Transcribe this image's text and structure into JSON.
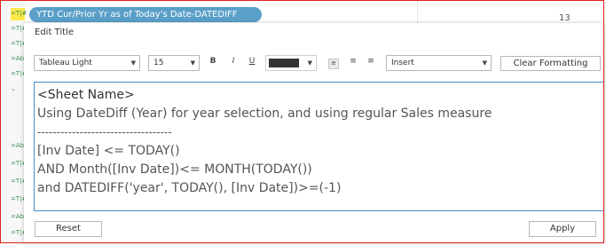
{
  "background": {
    "tab_label": "YTD Cur/Prior Yr as of Today's Date-DATEDIFF",
    "row_number": "13",
    "left_icons": [
      "=T|#",
      "=T|#",
      "=T|#",
      "=Abc",
      "=T|#",
      "=T|#",
      "=Abc",
      "=T|#",
      "=T|#",
      "=T|#",
      "=Abc",
      "=T|#"
    ]
  },
  "dialog": {
    "title": "Edit Title",
    "toolbar": {
      "font_family": "Tableau Light",
      "font_size": "15",
      "bold": "B",
      "italic": "I",
      "underline": "U",
      "text_color": "#333333",
      "insert_label": "Insert",
      "clear_formatting_label": "Clear Formatting"
    },
    "editor_lines": [
      "<Sheet Name>",
      "Using DateDiff (Year) for year selection, and using regular Sales measure",
      "-----------------------------------",
      "[Inv Date] <= TODAY()",
      "AND Month([Inv Date])<= MONTH(TODAY())",
      "and DATEDIFF('year', TODAY(), [Inv Date])>=(-1)"
    ],
    "reset_label": "Reset",
    "apply_label": "Apply"
  }
}
